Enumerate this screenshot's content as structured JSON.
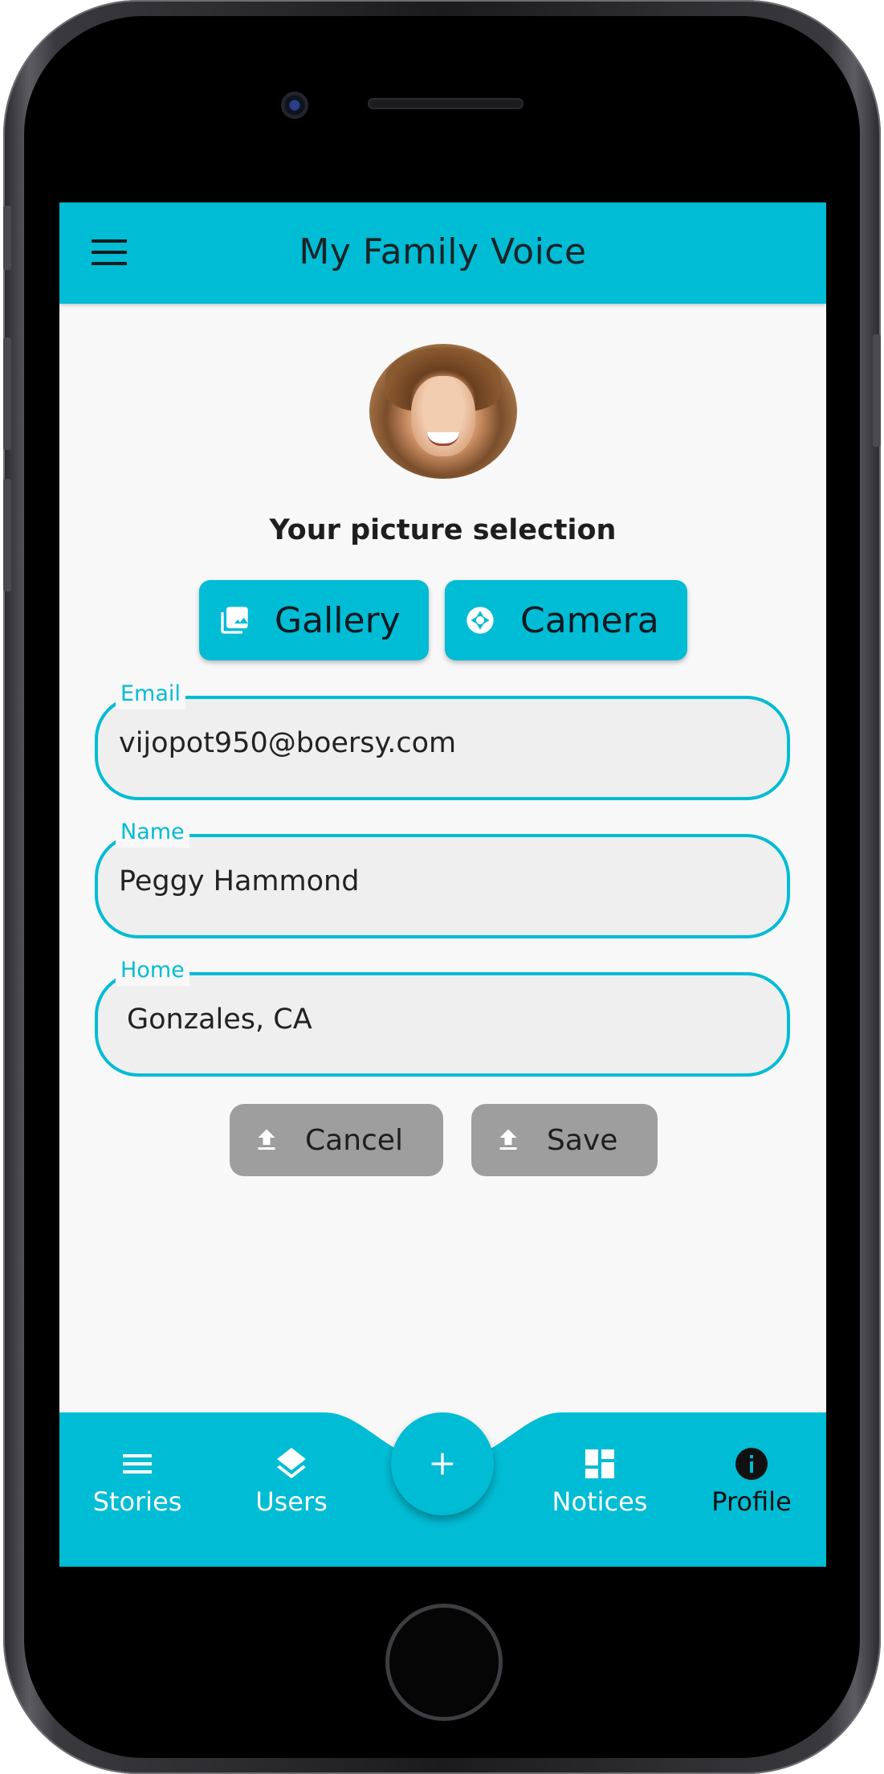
{
  "app": {
    "title": "My Family Voice"
  },
  "profile": {
    "picture_label": "Your picture selection",
    "gallery_label": "Gallery",
    "camera_label": "Camera"
  },
  "form": {
    "email": {
      "label": "Email",
      "value": "vijopot950@boersy.com"
    },
    "name": {
      "label": "Name",
      "value": "Peggy Hammond"
    },
    "home": {
      "label": "Home",
      "value": "Gonzales, CA"
    }
  },
  "actions": {
    "cancel_label": "Cancel",
    "save_label": "Save"
  },
  "nav": {
    "items": [
      {
        "label": "Stories",
        "icon": "list-icon"
      },
      {
        "label": "Users",
        "icon": "layers-icon"
      },
      {
        "label": "Notices",
        "icon": "dashboard-icon"
      },
      {
        "label": "Profile",
        "icon": "info-icon"
      }
    ],
    "active": "Profile",
    "fab_icon": "plus-icon"
  },
  "colors": {
    "accent": "#00bcd4",
    "button_gray": "#9e9e9e",
    "background": "#f8f8f8"
  }
}
